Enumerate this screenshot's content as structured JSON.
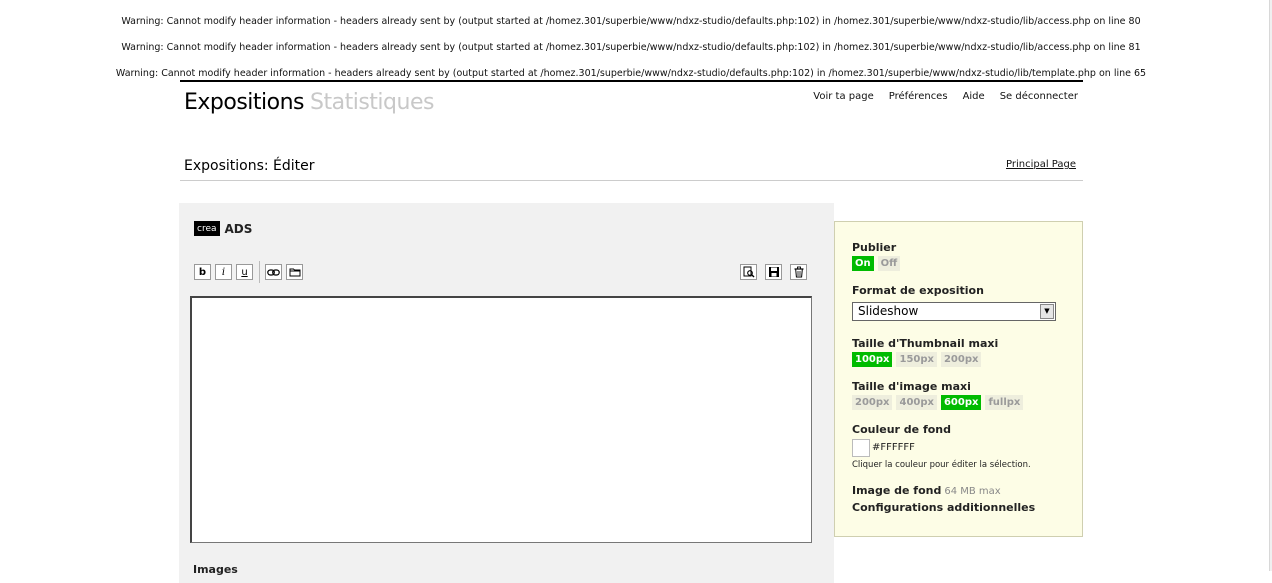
{
  "warnings": [
    "Warning: Cannot modify header information - headers already sent by (output started at /homez.301/superbie/www/ndxz-studio/defaults.php:102) in /homez.301/superbie/www/ndxz-studio/lib/access.php on line 80",
    "Warning: Cannot modify header information - headers already sent by (output started at /homez.301/superbie/www/ndxz-studio/defaults.php:102) in /homez.301/superbie/www/ndxz-studio/lib/access.php on line 81",
    "Warning: Cannot modify header information - headers already sent by (output started at /homez.301/superbie/www/ndxz-studio/defaults.php:102) in /homez.301/superbie/www/ndxz-studio/lib/template.php on line 65"
  ],
  "header": {
    "tab_active": "Expositions",
    "tab_inactive": "Statistiques",
    "nav": [
      "Voir ta page",
      "Préférences",
      "Aide",
      "Se déconnecter"
    ]
  },
  "breadcrumb": {
    "title": "Expositions: Éditer",
    "main_page_link": "Principal Page"
  },
  "editor": {
    "section_tag": "crea",
    "exhibit_title": "ADS",
    "format_buttons": {
      "bold": "b",
      "italic": "i",
      "underline": "u"
    },
    "content": "",
    "images_label": "Images"
  },
  "settings": {
    "publish": {
      "label": "Publier",
      "on": "On",
      "off": "Off",
      "selected": "On"
    },
    "format": {
      "label": "Format de exposition",
      "value": "Slideshow"
    },
    "thumb_size": {
      "label": "Taille d'Thumbnail maxi",
      "options": [
        "100px",
        "150px",
        "200px"
      ],
      "selected": "100px"
    },
    "image_size": {
      "label": "Taille d'image maxi",
      "options": [
        "200px",
        "400px",
        "600px",
        "fullpx"
      ],
      "selected": "600px"
    },
    "bg_color": {
      "label": "Couleur de fond",
      "value": "#FFFFFF",
      "hint": "Cliquer la couleur pour éditer la sélection."
    },
    "bg_image": {
      "label": "Image de fond",
      "note": "64 MB max"
    },
    "additional": "Configurations additionnelles"
  },
  "colors": {
    "selected": "#00bb00",
    "settings_bg": "#fdfde6",
    "panel_bg": "#f1f1f1"
  },
  "icons": [
    "bold-icon",
    "italic-icon",
    "underline-icon",
    "link-icon",
    "folder-icon",
    "preview-icon",
    "save-icon",
    "trash-icon"
  ]
}
